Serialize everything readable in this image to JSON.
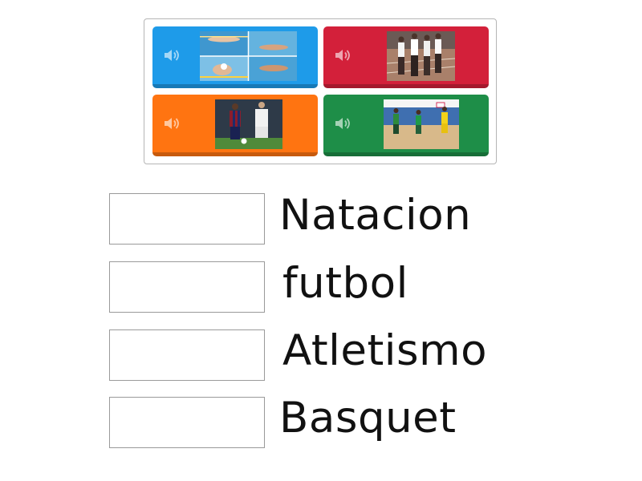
{
  "tiles": [
    {
      "id": "swimming",
      "color": "#1e9be9",
      "audio_icon": "speaker-icon",
      "image": "swimming-photo"
    },
    {
      "id": "athletics",
      "color": "#d3203a",
      "audio_icon": "speaker-icon",
      "image": "athletics-photo"
    },
    {
      "id": "football",
      "color": "#ff7411",
      "audio_icon": "speaker-icon",
      "image": "football-photo"
    },
    {
      "id": "basketball",
      "color": "#1e8e48",
      "audio_icon": "speaker-icon",
      "image": "basketball-photo"
    }
  ],
  "targets": [
    {
      "label": "Natacion"
    },
    {
      "label": "futbol"
    },
    {
      "label": "Atletismo"
    },
    {
      "label": "Basquet"
    }
  ]
}
